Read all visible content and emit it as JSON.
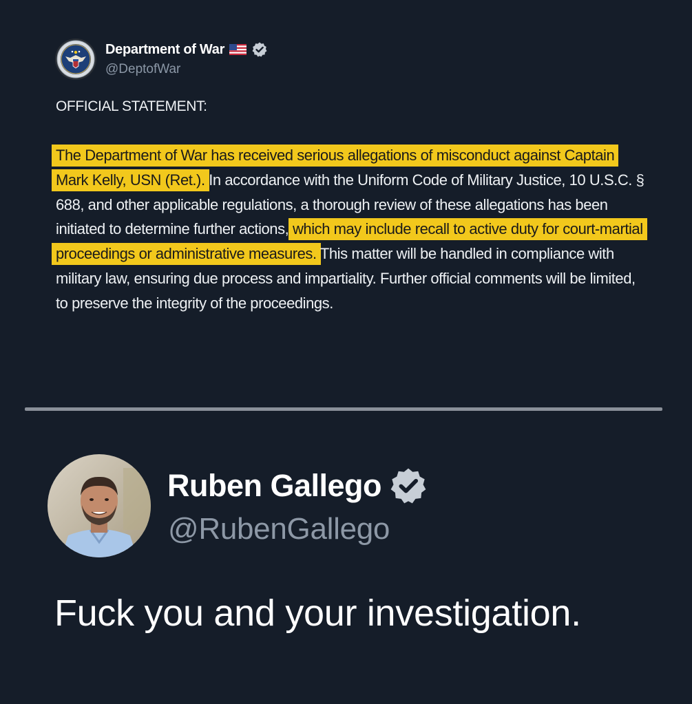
{
  "post1": {
    "author_name": "Department of War",
    "handle": "@DeptofWar",
    "avatar_icon": "dod-seal-icon",
    "flag_icon": "us-flag-icon",
    "verified_icon": "verified-badge-icon",
    "heading": "OFFICIAL STATEMENT:",
    "body_segments": [
      {
        "text": "The Department of War has received serious allegations of misconduct against Captain Mark Kelly, USN (Ret.).",
        "highlight": true
      },
      {
        "text": " In accordance with the Uniform Code of Military Justice, 10 U.S.C. § 688, and other applicable regulations, a thorough review of these allegations has been initiated to determine further actions, ",
        "highlight": false
      },
      {
        "text": "which may include recall to active duty for court-martial proceedings or administrative measures.",
        "highlight": true
      },
      {
        "text": " This matter will be handled in compliance with military law, ensuring due process and impartiality. Further official comments will be limited, to preserve the integrity of the proceedings.",
        "highlight": false
      }
    ]
  },
  "post2": {
    "author_name": "Ruben Gallego",
    "handle": "@RubenGallego",
    "avatar_icon": "profile-photo-avatar",
    "verified_icon": "verified-badge-icon",
    "text": "Fuck you and your investigation."
  },
  "colors": {
    "background": "#151d29",
    "highlight": "#f2c81c",
    "text_primary": "#eef1f4",
    "text_secondary": "#8b97a6",
    "divider": "#8a9099",
    "verified_badge": "#c7ced6"
  }
}
